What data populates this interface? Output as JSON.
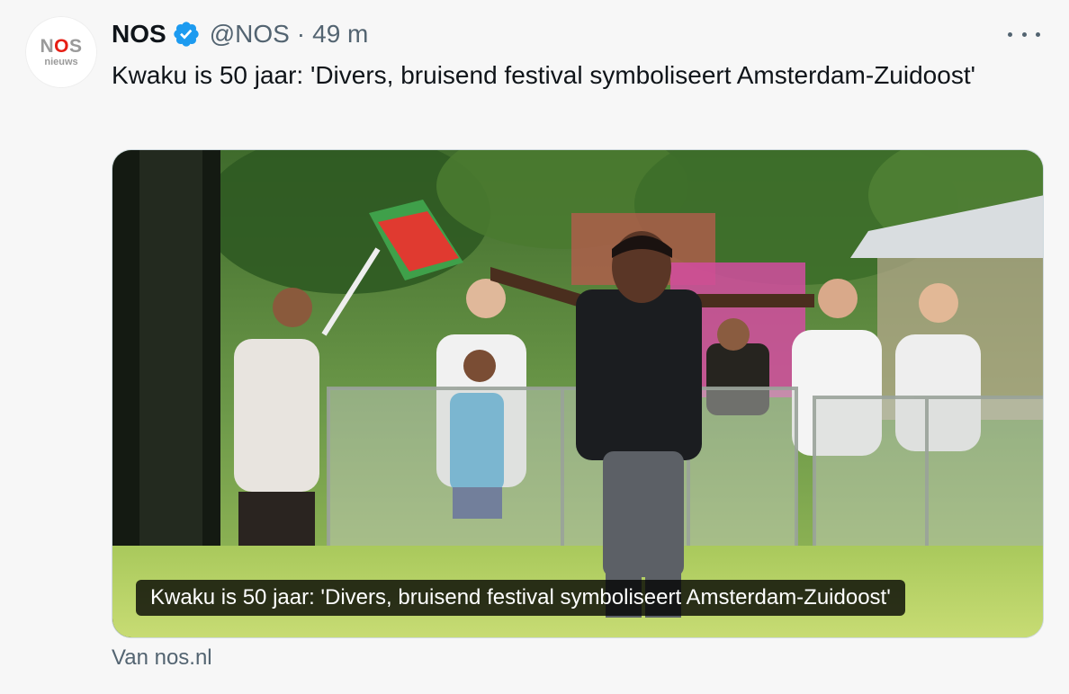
{
  "account": {
    "avatar_logo_text": "NOS",
    "avatar_sub_text": "nieuws",
    "display_name": "NOS",
    "handle": "@NOS",
    "separator": "·",
    "time": "49 m",
    "verified_icon": "verified-badge-icon",
    "verified_color": "#1d9bf0"
  },
  "tweet": {
    "text": "Kwaku is 50 jaar: 'Divers, bruisend festival symboliseert Amsterdam-Zuidoost'",
    "more_icon": "more-options-icon"
  },
  "card": {
    "caption": "Kwaku is 50 jaar: 'Divers, bruisend festival symboliseert Amsterdam-Zuidoost'",
    "image_description_icon": "festival-photo",
    "source": "Van nos.nl"
  },
  "colors": {
    "text_primary": "#0f1419",
    "text_secondary": "#536471",
    "background": "#f7f7f7",
    "nos_red": "#e61e14"
  }
}
